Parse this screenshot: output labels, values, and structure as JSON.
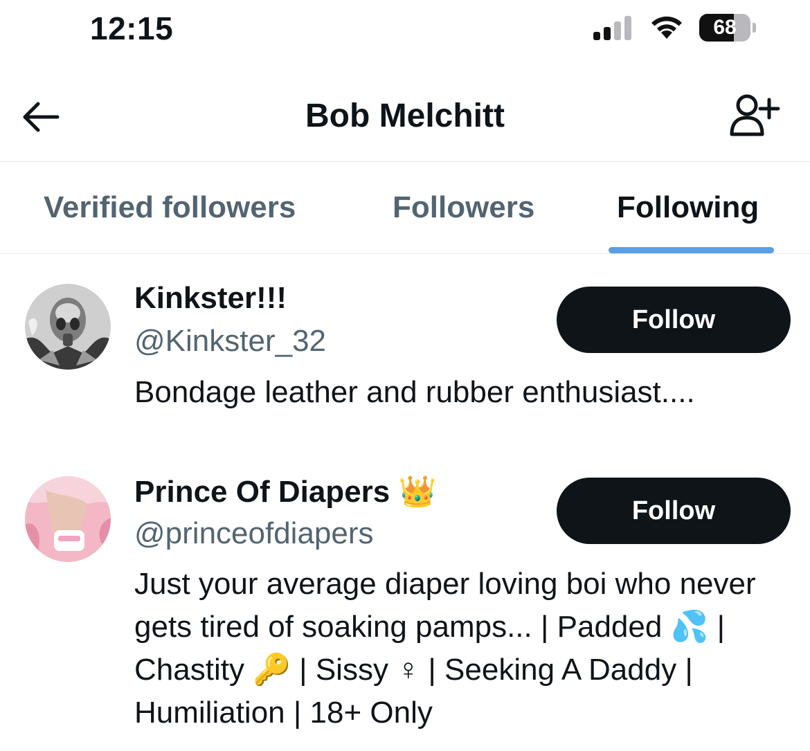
{
  "status_bar": {
    "time": "12:15",
    "battery_level": "68",
    "battery_fraction": 0.68,
    "signal_bars_active": 2,
    "signal_bars_total": 4,
    "icons": [
      "signal-icon",
      "wifi-icon",
      "battery-icon"
    ]
  },
  "header": {
    "title": "Bob Melchitt",
    "icons": [
      "back-arrow-icon",
      "add-user-icon"
    ]
  },
  "tabs": [
    {
      "label": "Verified followers",
      "active": false
    },
    {
      "label": "Followers",
      "active": false
    },
    {
      "label": "Following",
      "active": true
    }
  ],
  "colors": {
    "text_primary": "#0f1419",
    "text_secondary": "#536471",
    "tab_indicator": "#5b9de6",
    "follow_button_bg": "#0f1419",
    "divider": "#e4e8eb"
  },
  "users": [
    {
      "display_name": "Kinkster!!!",
      "handle": "@Kinkster_32",
      "bio": "Bondage leather and rubber enthusiast....",
      "follow_label": "Follow"
    },
    {
      "display_name": "Prince Of Diapers 👑",
      "handle": "@princeofdiapers",
      "bio": "Just your average diaper loving boi who never gets tired of soaking pamps... | Padded 💦 | Chastity 🔑 | Sissy ♀ | Seeking A Daddy | Humiliation | 18+ Only",
      "follow_label": "Follow"
    }
  ]
}
